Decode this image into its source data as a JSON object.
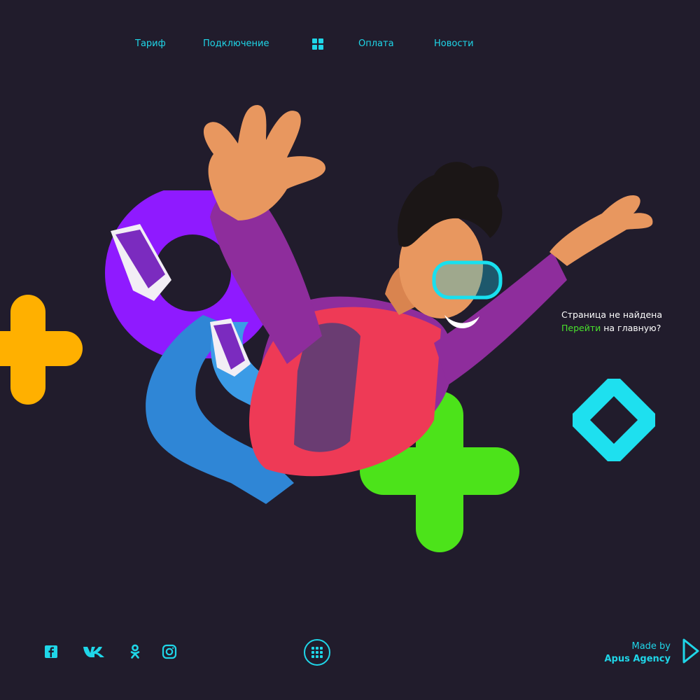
{
  "nav": {
    "items": [
      {
        "label": "Тариф"
      },
      {
        "label": "Подключение"
      },
      {
        "label": "Оплата"
      },
      {
        "label": "Новости"
      }
    ]
  },
  "message": {
    "line1": "Страница не найдена",
    "link_label": "Перейти",
    "line2_rest": " на главную?"
  },
  "footer": {
    "social_icons": [
      "facebook-icon",
      "vk-icon",
      "odnoklassniki-icon",
      "instagram-icon"
    ],
    "menu_icon": "grid-icon",
    "credit_line1": "Made by",
    "credit_line2": "Apus Agency"
  },
  "colors": {
    "background": "#211c2c",
    "accent_cyan": "#1fd6e8",
    "green": "#49e22c",
    "purple": "#8f1aff",
    "orange": "#ffb000"
  }
}
